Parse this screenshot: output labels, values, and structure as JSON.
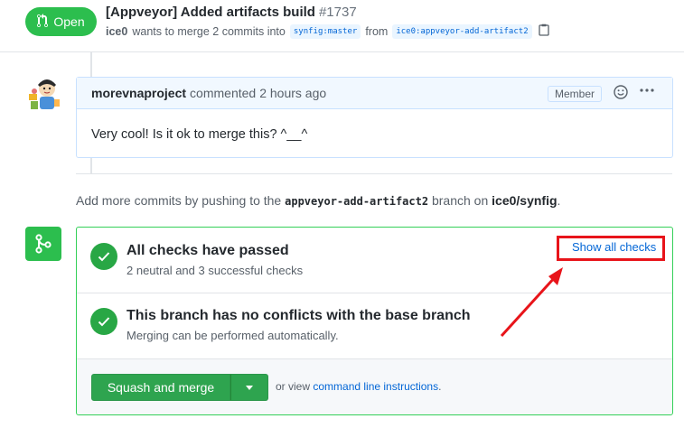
{
  "header": {
    "state": "Open",
    "title": "[Appveyor] Added artifacts build",
    "number": "#1737",
    "author": "ice0",
    "merge_text": "wants to merge 2 commits into",
    "base_branch": "synfig:master",
    "from_text": "from",
    "head_branch": "ice0:appveyor-add-artifact2"
  },
  "comment": {
    "author": "morevnaproject",
    "action": "commented",
    "timestamp": "2 hours ago",
    "role_label": "Member",
    "body": "Very cool! Is it ok to merge this? ^__^"
  },
  "hint": {
    "prefix": "Add more commits by pushing to the",
    "branch": "appveyor-add-artifact2",
    "middle": "branch on",
    "repo": "ice0/synfig",
    "suffix": "."
  },
  "merge": {
    "checks_title": "All checks have passed",
    "checks_sub": "2 neutral and 3 successful checks",
    "show_checks": "Show all checks",
    "conflicts_title": "This branch has no conflicts with the base branch",
    "conflicts_sub": "Merging can be performed automatically.",
    "button_label": "Squash and merge",
    "alt_prefix": "or view",
    "alt_link": "command line instructions",
    "alt_suffix": "."
  },
  "colors": {
    "open_green": "#2cbe4e",
    "link_blue": "#0366d6",
    "annotation_red": "#e8141a"
  },
  "icons": [
    "git-pull-request-icon",
    "clipboard-icon",
    "smiley-icon",
    "kebab-icon",
    "git-merge-icon",
    "check-icon",
    "caret-down-icon"
  ]
}
